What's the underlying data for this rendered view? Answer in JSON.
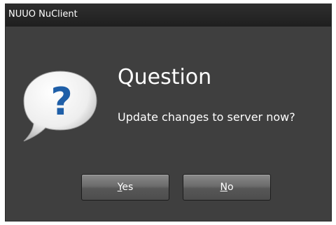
{
  "window": {
    "title": "NUUO NuClient"
  },
  "dialog": {
    "icon": "question-bubble-icon",
    "heading": "Question",
    "message": "Update changes to server now?"
  },
  "buttons": {
    "yes": {
      "accel": "Y",
      "rest": "es"
    },
    "no": {
      "accel": "N",
      "rest": "o"
    }
  },
  "colors": {
    "background": "#3f3f3f",
    "titlebar": "#262626",
    "icon_mark": "#1f5fa8",
    "text": "#ffffff"
  }
}
